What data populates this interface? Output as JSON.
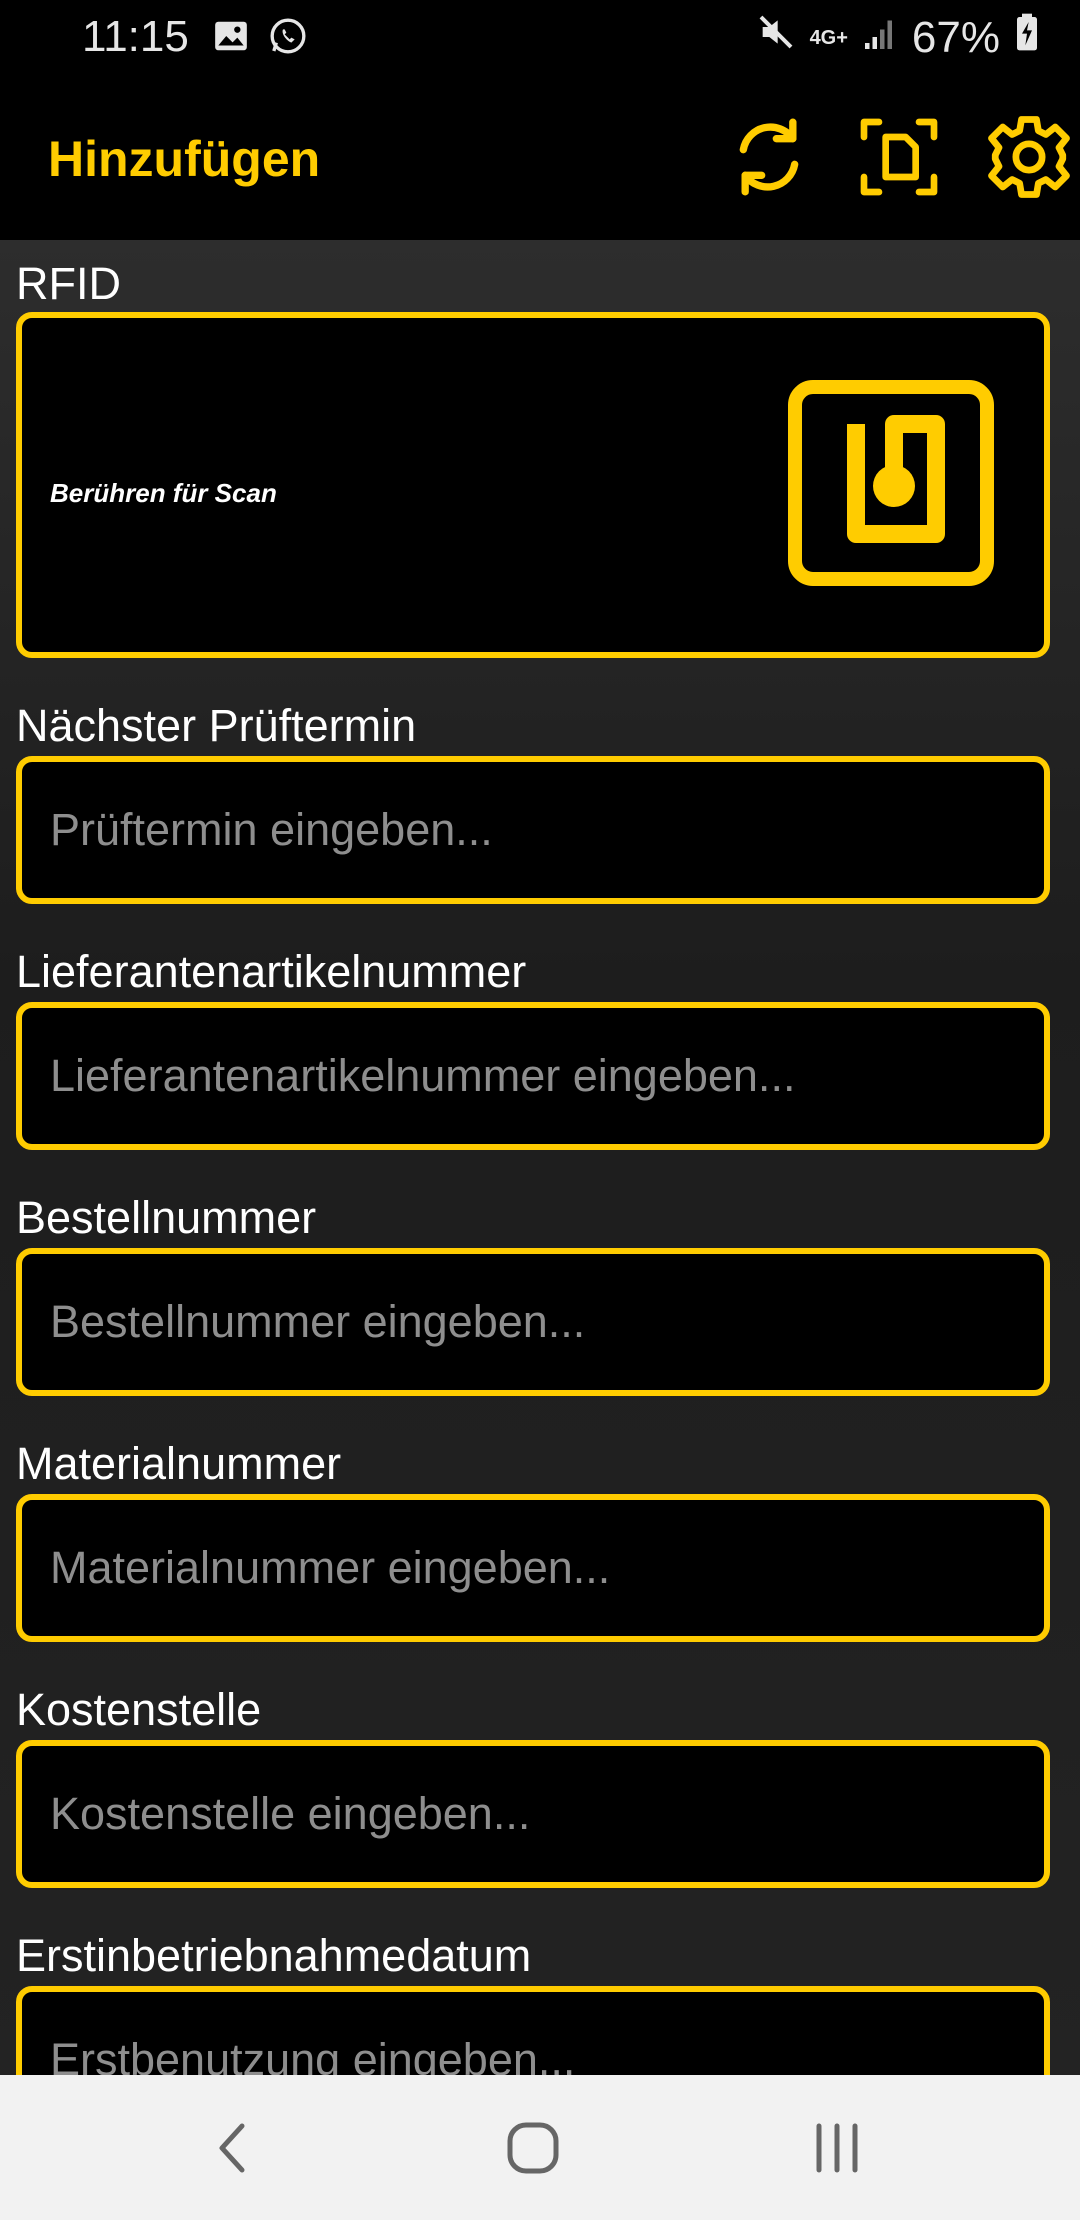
{
  "status_bar": {
    "time": "11:15",
    "battery": "67%",
    "network": "4G+",
    "icons": [
      "gallery-icon",
      "whatsapp-icon",
      "mute-icon",
      "network-4g-icon",
      "signal-icon",
      "battery-charging-icon"
    ]
  },
  "app_bar": {
    "title": "Hinzufügen",
    "actions": [
      "sync-icon",
      "document-scan-icon",
      "settings-gear-icon"
    ]
  },
  "rfid": {
    "label": "RFID",
    "hint": "Berühren für Scan",
    "icon": "rfid-tag-icon"
  },
  "fields": [
    {
      "label": "Nächster Prüftermin",
      "placeholder": "Prüftermin eingeben..."
    },
    {
      "label": "Lieferantenartikelnummer",
      "placeholder": "Lieferantenartikelnummer eingeben..."
    },
    {
      "label": "Bestellnummer",
      "placeholder": "Bestellnummer eingeben..."
    },
    {
      "label": "Materialnummer",
      "placeholder": "Materialnummer eingeben..."
    },
    {
      "label": "Kostenstelle",
      "placeholder": "Kostenstelle eingeben..."
    },
    {
      "label": "Erstinbetriebnahmedatum",
      "placeholder": "Erstbenutzung eingeben..."
    }
  ],
  "nav_bar": {
    "buttons": [
      "back-icon",
      "home-icon",
      "recent-apps-icon"
    ]
  },
  "colors": {
    "accent": "#ffcc00",
    "background": "#000000",
    "placeholder": "#8e8e8e",
    "nav_bar": "#f2f2f2"
  }
}
